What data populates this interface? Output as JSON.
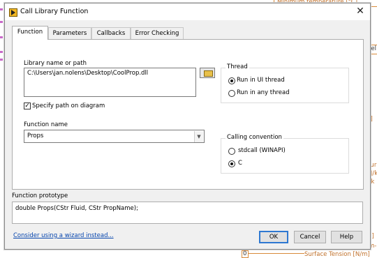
{
  "background": {
    "texts": [
      "Minimum temperature [°C]",
      "sel",
      "ol]",
      "sur",
      "kJ/k",
      "J/k",
      "s]",
      "m-",
      "Surface Tension [N/m]",
      "0"
    ]
  },
  "dialog": {
    "title": "Call Library Function",
    "tabs": [
      "Function",
      "Parameters",
      "Callbacks",
      "Error Checking"
    ],
    "library": {
      "label": "Library name or path",
      "value": "C:\\Users\\jan.nolens\\Desktop\\CoolProp.dll"
    },
    "specify_path": {
      "label": "Specify path on diagram",
      "checked": true
    },
    "function_name": {
      "label": "Function name",
      "value": "Props"
    },
    "thread": {
      "title": "Thread",
      "options": [
        "Run in UI thread",
        "Run in any thread"
      ],
      "selected": "Run in UI thread"
    },
    "calling_convention": {
      "title": "Calling convention",
      "options": [
        "stdcall (WINAPI)",
        "C"
      ],
      "selected": "C"
    },
    "prototype": {
      "label": "Function prototype",
      "text": "double Props(CStr Fluid, CStr PropName);"
    },
    "wizard_link": "Consider using a wizard instead...",
    "buttons": {
      "ok": "OK",
      "cancel": "Cancel",
      "help": "Help"
    }
  }
}
